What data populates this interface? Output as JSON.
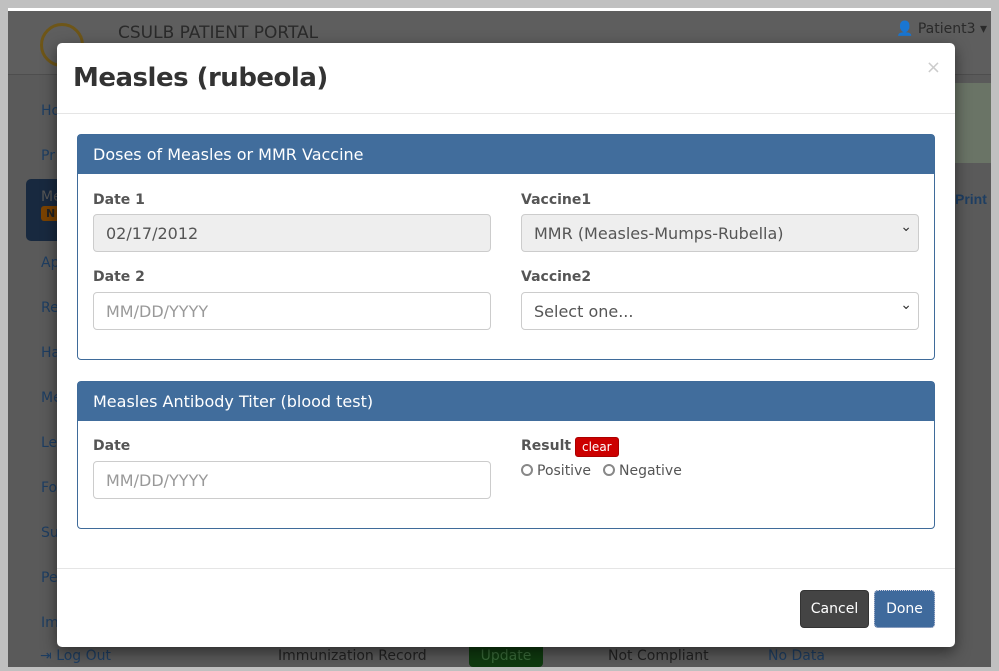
{
  "background": {
    "brand": "CSULB PATIENT PORTAL",
    "user": "Patient3",
    "sidebar": [
      "Ho",
      "Pr",
      "Me",
      "Ap",
      "Re",
      "Ha",
      "Me",
      "Le",
      "Fo",
      "Su",
      "Pe",
      "Im"
    ],
    "active_badge": "N",
    "logout": "Log Out",
    "print": "Print",
    "row": {
      "name": "Immunization Record",
      "button": "Update",
      "status": "Not Compliant",
      "data": "No Data"
    }
  },
  "modal": {
    "title": "Measles (rubeola)",
    "close": "×",
    "doses": {
      "header": "Doses of Measles or MMR Vaccine",
      "date1_label": "Date 1",
      "date1_value": "02/17/2012",
      "vaccine1_label": "Vaccine1",
      "vaccine1_value": "MMR (Measles-Mumps-Rubella)",
      "date2_label": "Date 2",
      "date2_placeholder": "MM/DD/YYYY",
      "vaccine2_label": "Vaccine2",
      "vaccine2_value": "Select one..."
    },
    "titer": {
      "header": "Measles Antibody Titer (blood test)",
      "date_label": "Date",
      "date_placeholder": "MM/DD/YYYY",
      "result_label": "Result",
      "clear": "clear",
      "options": [
        "Positive",
        "Negative"
      ]
    },
    "cancel": "Cancel",
    "done": "Done"
  }
}
